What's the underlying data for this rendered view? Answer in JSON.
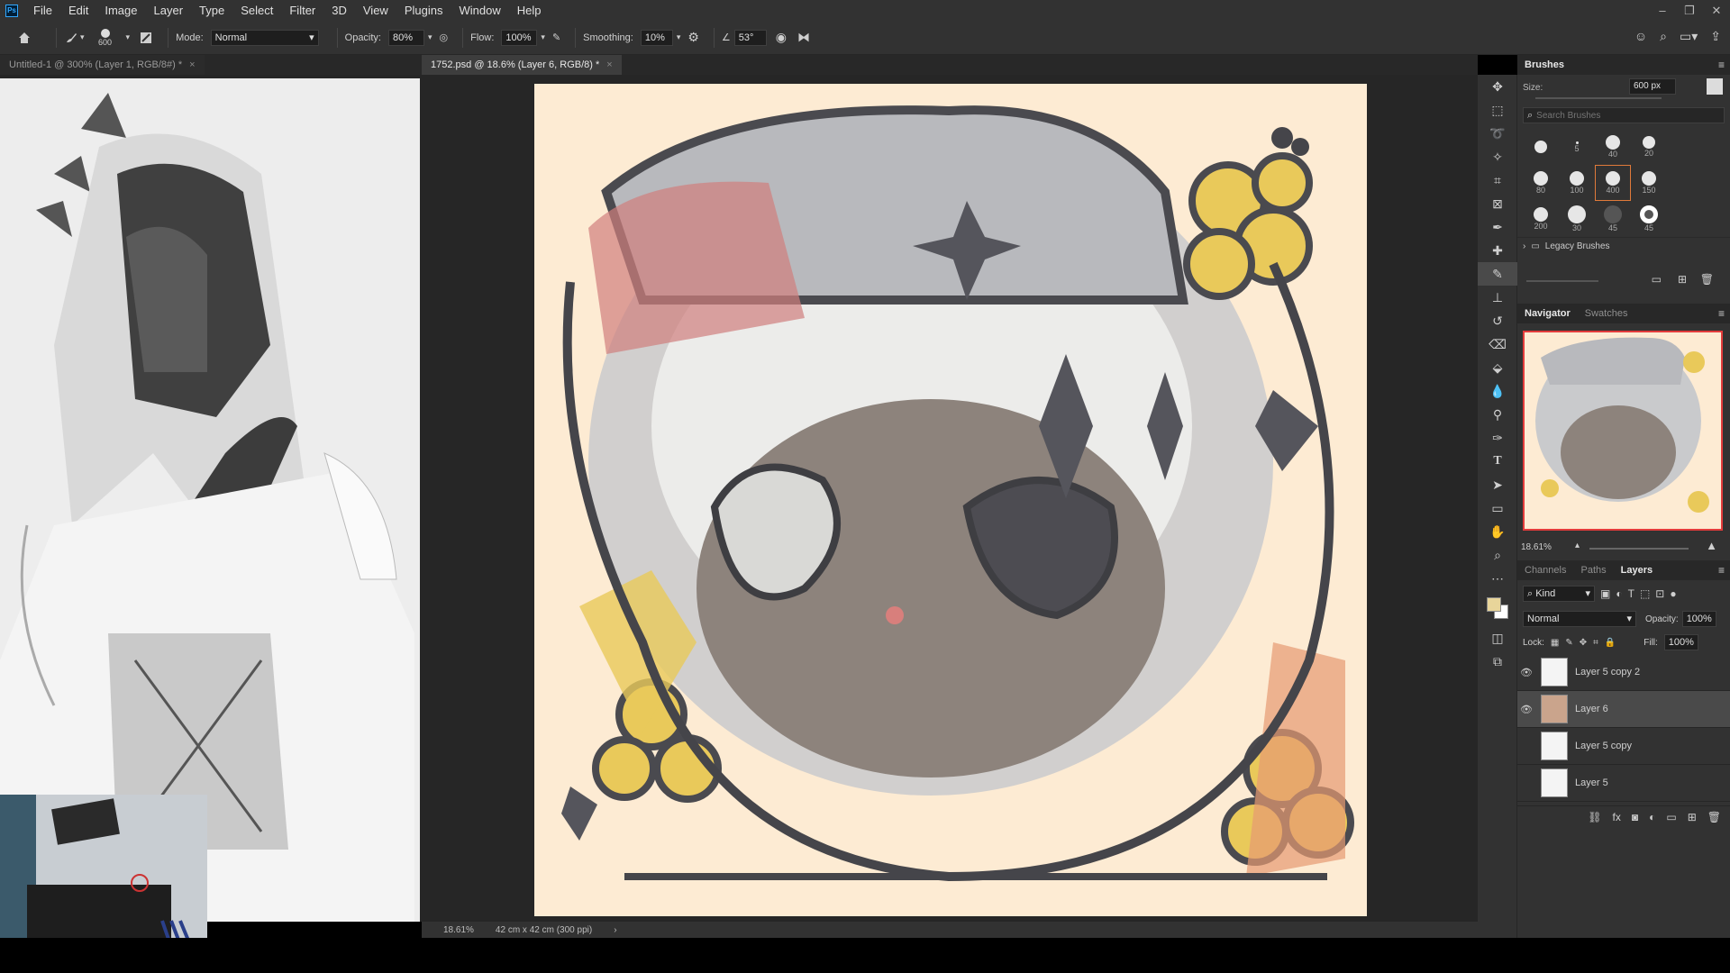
{
  "app": {
    "logo": "Ps"
  },
  "menu": [
    "File",
    "Edit",
    "Image",
    "Layer",
    "Type",
    "Select",
    "Filter",
    "3D",
    "View",
    "Plugins",
    "Window",
    "Help"
  ],
  "options": {
    "brush_size": "600",
    "mode_label": "Mode:",
    "mode_value": "Normal",
    "opacity_label": "Opacity:",
    "opacity_value": "80%",
    "flow_label": "Flow:",
    "flow_value": "100%",
    "smoothing_label": "Smoothing:",
    "smoothing_value": "10%",
    "angle_value": "53°"
  },
  "tabs": {
    "left": "Untitled-1 @ 300% (Layer 1, RGB/8#) *",
    "main": "1752.psd @ 18.6% (Layer 6, RGB/8) *"
  },
  "status": {
    "zoom": "18.61%",
    "size": "42 cm x 42 cm (300 ppi)"
  },
  "brushes": {
    "tab": "Brushes",
    "size_label": "Size:",
    "size_value": "600 px",
    "search_placeholder": "Search Brushes",
    "presets": [
      "",
      "5",
      "40",
      "20",
      "80",
      "100",
      "400",
      "150",
      "200",
      "30",
      "45",
      "45"
    ],
    "legacy": "Legacy Brushes"
  },
  "navigator": {
    "tabs": [
      "Navigator",
      "Swatches"
    ],
    "zoom": "18.61%"
  },
  "layers": {
    "tabs": [
      "Channels",
      "Paths",
      "Layers"
    ],
    "kind": "Kind",
    "blend": "Normal",
    "opacity_label": "Opacity:",
    "opacity_value": "100%",
    "lock_label": "Lock:",
    "fill_label": "Fill:",
    "fill_value": "100%",
    "items": [
      {
        "name": "Layer 5 copy 2",
        "visible": true
      },
      {
        "name": "Layer 6",
        "visible": true
      },
      {
        "name": "Layer 5 copy",
        "visible": false
      },
      {
        "name": "Layer 5",
        "visible": false
      }
    ]
  },
  "colors": {
    "foreground": "#e8d59a",
    "background": "#ffffff",
    "canvas_bg": "#fdebd3"
  }
}
